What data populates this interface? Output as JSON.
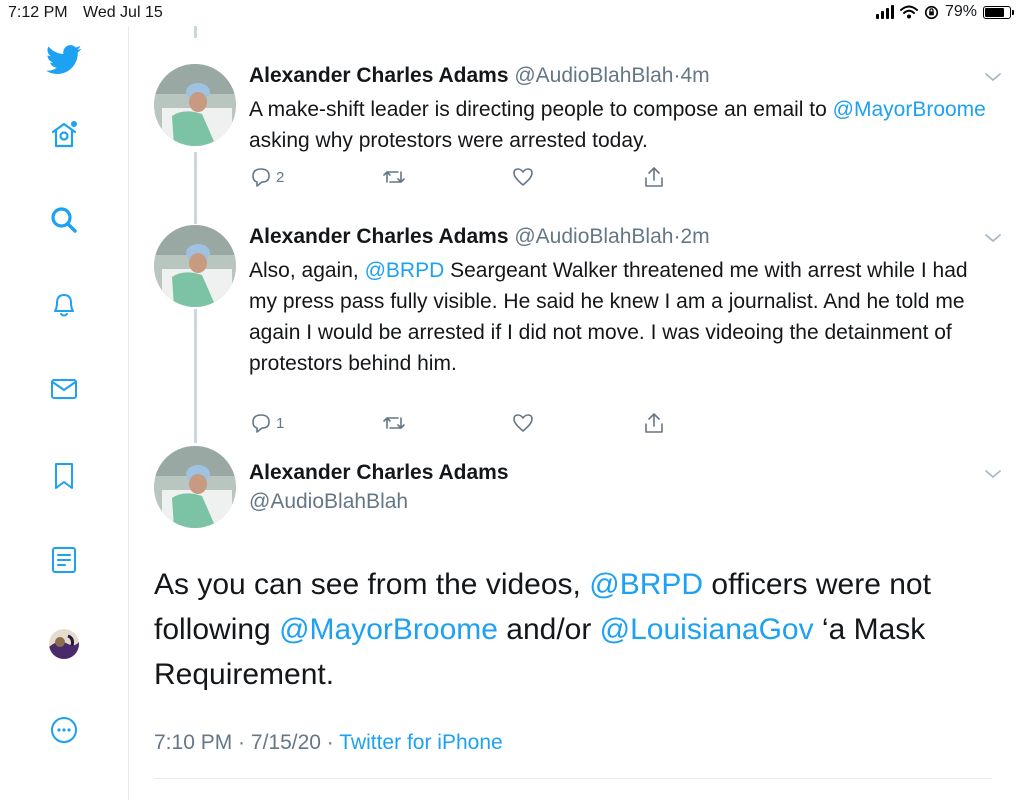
{
  "status_bar": {
    "time": "7:12 PM",
    "date": "Wed Jul 15",
    "battery_text": "79%",
    "battery_level": 0.79
  },
  "sidebar": {
    "icons": [
      "twitter-bird-icon",
      "home-icon",
      "search-icon",
      "notifications-bell-icon",
      "messages-mail-icon",
      "bookmarks-icon",
      "lists-icon",
      "profile-avatar-icon",
      "more-icon"
    ],
    "accent": "#1da1f2"
  },
  "thread": [
    {
      "name": "Alexander Charles Adams",
      "handle": "@AudioBlahBlah",
      "dot": "·",
      "age": "4m",
      "text_parts": [
        {
          "text": "A make-shift leader is directing people to compose an email to ",
          "mention": false
        },
        {
          "text": "@MayorBroome",
          "mention": true
        },
        {
          "text": " asking why protestors were arrested today.",
          "mention": false
        }
      ],
      "reply_count": "2"
    },
    {
      "name": "Alexander Charles Adams",
      "handle": "@AudioBlahBlah",
      "dot": "·",
      "age": "2m",
      "text_parts": [
        {
          "text": "Also, again, ",
          "mention": false
        },
        {
          "text": "@BRPD",
          "mention": true
        },
        {
          "text": " Seargeant Walker threatened me with arrest while I had my press pass fully visible. He said he knew I am a journalist. And he told me again I would be arrested if I did not move. I was videoing the detainment of protestors behind him.",
          "mention": false
        }
      ],
      "reply_count": "1"
    }
  ],
  "focused_tweet": {
    "name": "Alexander Charles Adams",
    "handle": "@AudioBlahBlah",
    "text_parts": [
      {
        "text": "As you can see from the videos, ",
        "mention": false
      },
      {
        "text": "@BRPD",
        "mention": true
      },
      {
        "text": " officers were not following ",
        "mention": false
      },
      {
        "text": "@MayorBroome",
        "mention": true
      },
      {
        "text": " and/or ",
        "mention": false
      },
      {
        "text": "@LouisianaGov",
        "mention": true
      },
      {
        "text": " ‘a Mask Requirement.",
        "mention": false
      }
    ],
    "time": "7:10 PM",
    "sep1": " · ",
    "date": "7/15/20",
    "sep2": " · ",
    "source": "Twitter for iPhone"
  },
  "colors": {
    "accent": "#1da1f2",
    "secondary_text": "#657786",
    "border": "#e6ecf0"
  }
}
